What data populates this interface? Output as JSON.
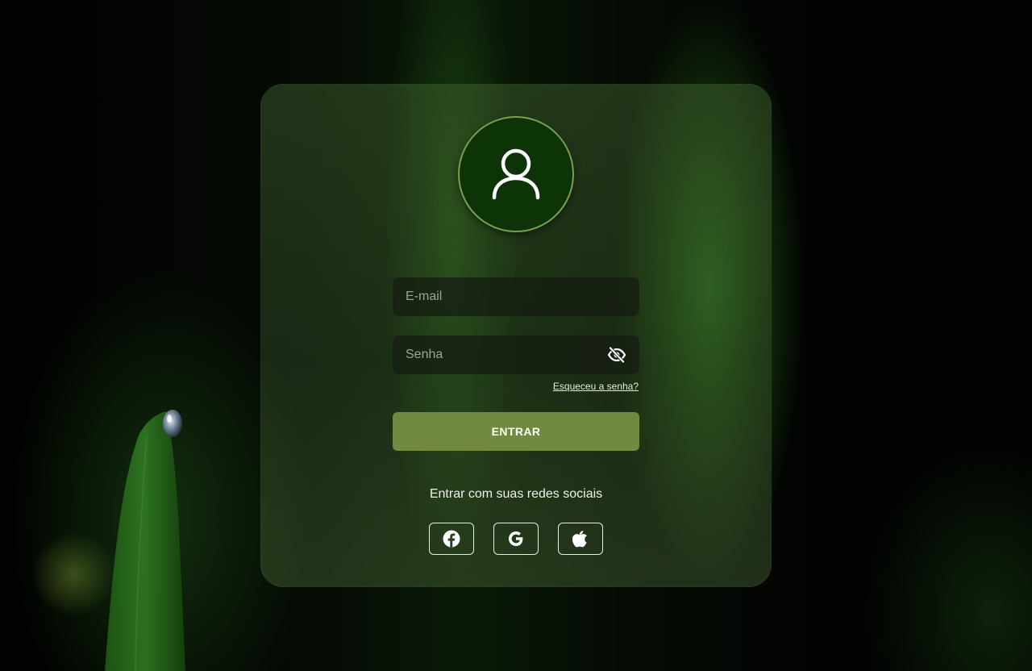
{
  "login": {
    "email_placeholder": "E-mail",
    "password_placeholder": "Senha",
    "forgot_password": "Esqueceu a senha?",
    "submit_label": "ENTRAR",
    "social_title": "Entrar com suas redes sociais"
  },
  "icons": {
    "avatar": "user-icon",
    "password_toggle": "eye-off-icon",
    "social": [
      "facebook-icon",
      "google-icon",
      "apple-icon"
    ]
  },
  "colors": {
    "accent_button": "#718a3f",
    "avatar_bg": "#0d3406",
    "avatar_border": "#7d9e4c"
  }
}
